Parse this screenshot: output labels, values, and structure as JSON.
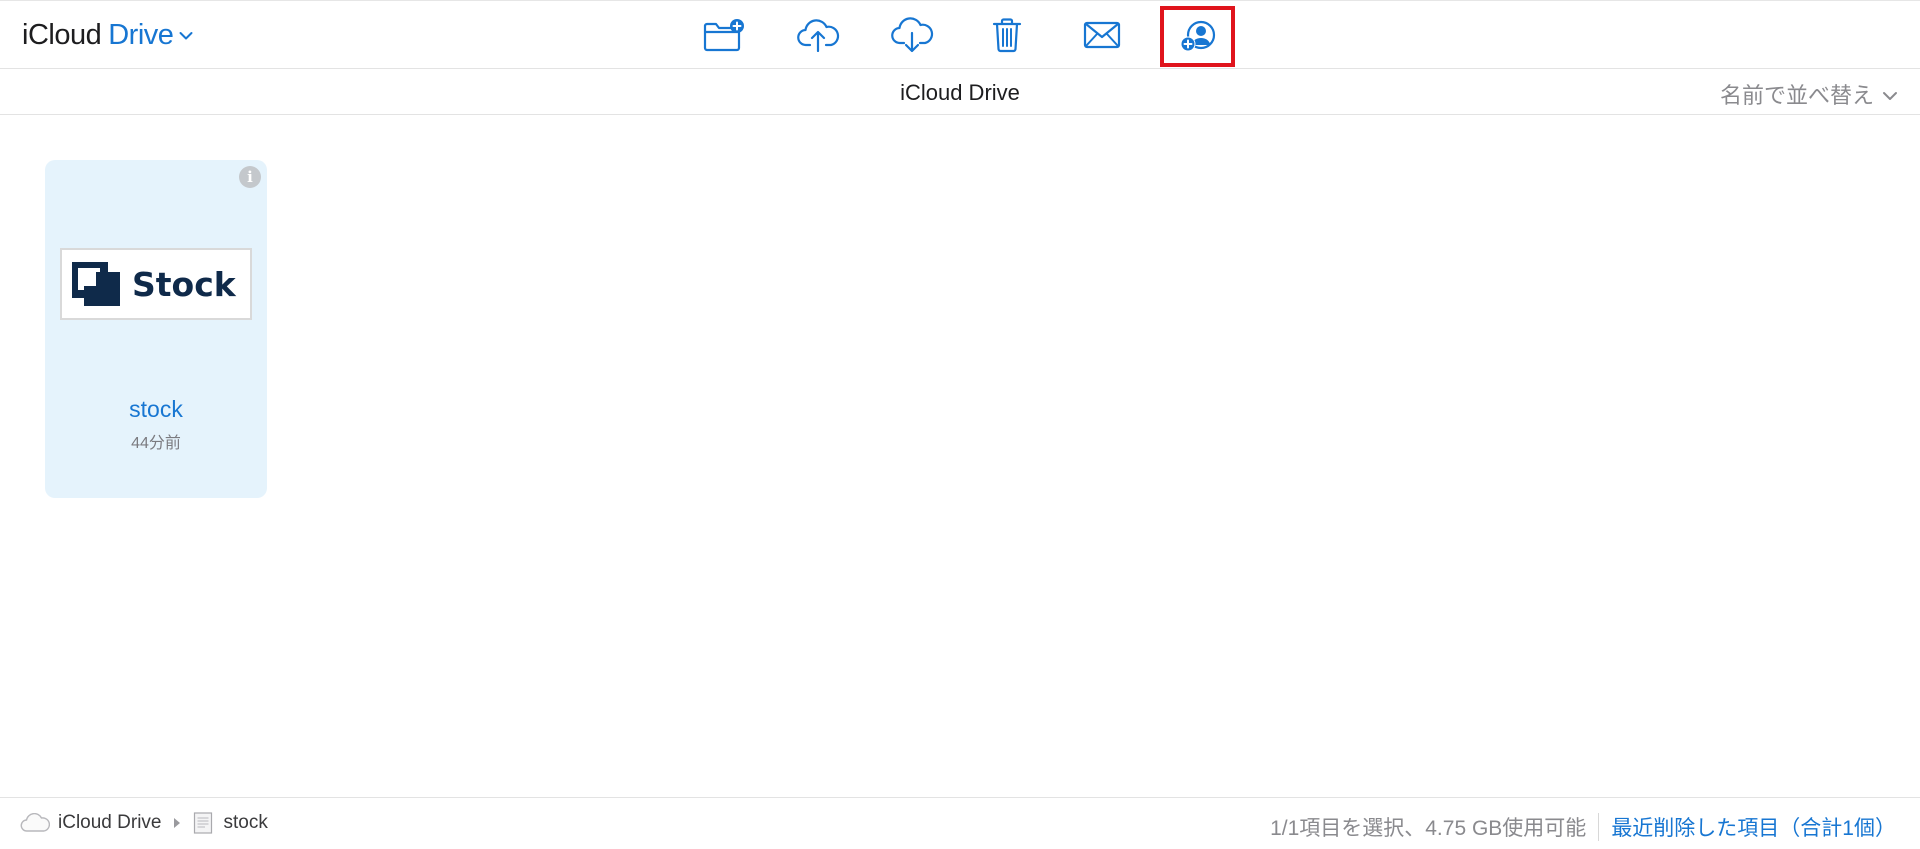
{
  "header": {
    "title_prefix": "iCloud",
    "title_accent": "Drive"
  },
  "toolbar": {
    "items": [
      {
        "name": "new-folder",
        "icon": "folder-plus-icon"
      },
      {
        "name": "upload",
        "icon": "cloud-upload-icon"
      },
      {
        "name": "download",
        "icon": "cloud-download-icon"
      },
      {
        "name": "delete",
        "icon": "trash-icon"
      },
      {
        "name": "email",
        "icon": "envelope-icon"
      },
      {
        "name": "share-collaborate",
        "icon": "add-person-icon",
        "highlighted": true
      }
    ]
  },
  "subheader": {
    "location_title": "iCloud Drive",
    "sort_label": "名前で並べ替え"
  },
  "files": [
    {
      "name": "stock",
      "modified": "44分前",
      "thumbnail_text": "Stock"
    }
  ],
  "footer": {
    "breadcrumbs": [
      {
        "label": "iCloud Drive",
        "icon": "cloud-icon"
      },
      {
        "label": "stock",
        "icon": "document-icon"
      }
    ],
    "status": "1/1項目を選択、4.75 GB使用可能",
    "recently_deleted": "最近削除した項目（合計1個）"
  },
  "colors": {
    "accent": "#1776d2",
    "highlight_border": "#e0141c",
    "card_bg": "#e5f3fc",
    "logo_navy": "#0f2a4a"
  }
}
